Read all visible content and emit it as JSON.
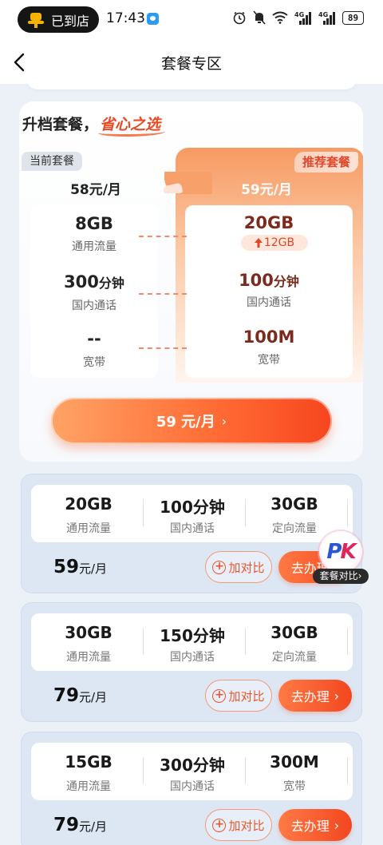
{
  "status_bar": {
    "store_pill": "已到店",
    "time": "17:43",
    "signal_1": "4G",
    "signal_2": "4G",
    "battery": "89"
  },
  "nav": {
    "title": "套餐专区"
  },
  "upgrade": {
    "title_prefix": "升档套餐，",
    "title_slogan": "省心之选",
    "current_tag": "当前套餐",
    "recommend_tag": "推荐套餐",
    "current_price": "58元/月",
    "recommended_price": "59元/月",
    "rows": [
      {
        "current_value": "8GB",
        "current_unit": "",
        "recommended_value": "20GB",
        "recommended_unit": "",
        "label": "通用流量",
        "increase": "12GB"
      },
      {
        "current_value": "300",
        "current_unit": "分钟",
        "recommended_value": "100",
        "recommended_unit": "分钟",
        "label": "国内通话"
      },
      {
        "current_value": "--",
        "current_unit": "",
        "recommended_value": "100M",
        "recommended_unit": "",
        "label": "宽带"
      }
    ],
    "cta_price": "59 元/月",
    "cta_arrow": "›"
  },
  "plans": [
    {
      "features": [
        {
          "value": "20GB",
          "label": "通用流量"
        },
        {
          "value": "100分钟",
          "label": "国内通话"
        },
        {
          "value": "30GB",
          "label": "定向流量"
        }
      ],
      "price": "59",
      "unit": "元/月",
      "compare_label": "加对比",
      "go_label": "去办理"
    },
    {
      "features": [
        {
          "value": "30GB",
          "label": "通用流量"
        },
        {
          "value": "150分钟",
          "label": "国内通话"
        },
        {
          "value": "30GB",
          "label": "定向流量"
        }
      ],
      "price": "79",
      "unit": "元/月",
      "compare_label": "加对比",
      "go_label": "去办理"
    },
    {
      "features": [
        {
          "value": "15GB",
          "label": "通用流量"
        },
        {
          "value": "300分钟",
          "label": "国内通话"
        },
        {
          "value": "300M",
          "label": "宽带"
        }
      ],
      "price": "79",
      "unit": "元/月",
      "compare_label": "加对比",
      "go_label": "去办理"
    }
  ],
  "pk_float": {
    "p": "P",
    "k": "K",
    "label": "套餐对比›"
  },
  "colors": {
    "accent": "#f4521f",
    "recommend_text": "#7a2b1d",
    "card_bg": "#dde7f4"
  }
}
